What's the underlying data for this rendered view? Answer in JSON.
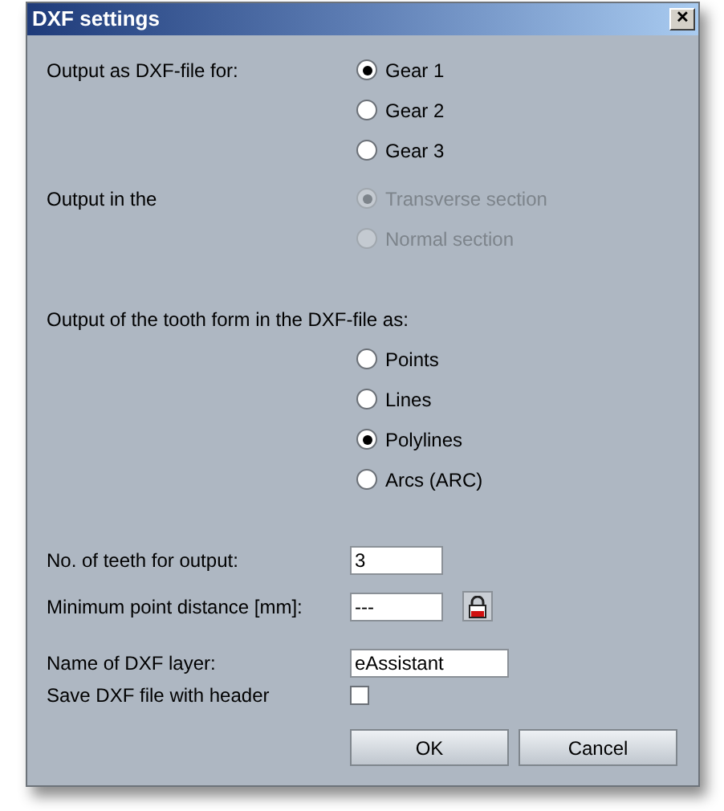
{
  "window": {
    "title": "DXF settings",
    "close": "✕"
  },
  "output_for": {
    "label": "Output as DXF-file for:",
    "options": [
      {
        "label": "Gear 1",
        "selected": true,
        "disabled": false
      },
      {
        "label": "Gear 2",
        "selected": false,
        "disabled": false
      },
      {
        "label": "Gear 3",
        "selected": false,
        "disabled": false
      }
    ]
  },
  "output_in": {
    "label": "Output in the",
    "options": [
      {
        "label": "Transverse section",
        "selected": true,
        "disabled": true
      },
      {
        "label": "Normal section",
        "selected": false,
        "disabled": true
      }
    ]
  },
  "tooth_form": {
    "label": "Output of the tooth form in the DXF-file as:",
    "options": [
      {
        "label": "Points",
        "selected": false,
        "disabled": false
      },
      {
        "label": "Lines",
        "selected": false,
        "disabled": false
      },
      {
        "label": "Polylines",
        "selected": true,
        "disabled": false
      },
      {
        "label": "Arcs (ARC)",
        "selected": false,
        "disabled": false
      }
    ]
  },
  "teeth": {
    "label": "No. of teeth for output:",
    "value": "3"
  },
  "min_distance": {
    "label": "Minimum point distance [mm]:",
    "value": "---"
  },
  "layer": {
    "label": "Name of DXF layer:",
    "value": "eAssistant"
  },
  "header": {
    "label": "Save DXF file with header",
    "checked": false
  },
  "buttons": [
    "OK",
    "Cancel"
  ]
}
